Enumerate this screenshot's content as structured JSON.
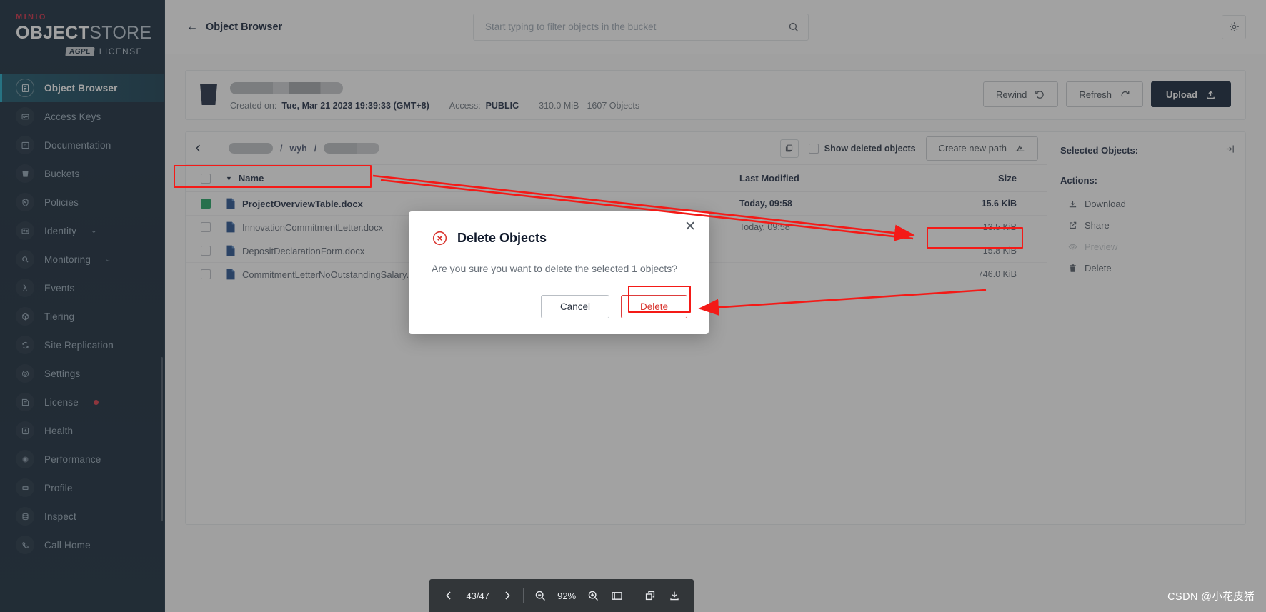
{
  "brand": {
    "minio": "MINIO",
    "object": "OBJECT",
    "store": "STORE",
    "badge": "AGPL",
    "license": "LICENSE"
  },
  "sidebar": {
    "items": [
      {
        "label": "Object Browser",
        "icon": "object-browser-icon",
        "active": true
      },
      {
        "label": "Access Keys",
        "icon": "key-icon"
      },
      {
        "label": "Documentation",
        "icon": "book-icon"
      },
      {
        "label": "Buckets",
        "icon": "bucket-icon"
      },
      {
        "label": "Policies",
        "icon": "shield-icon"
      },
      {
        "label": "Identity",
        "icon": "identity-icon",
        "chevron": "⌄"
      },
      {
        "label": "Monitoring",
        "icon": "magnifier-icon",
        "chevron": "⌄"
      },
      {
        "label": "Events",
        "icon": "lambda-icon"
      },
      {
        "label": "Tiering",
        "icon": "cube-icon"
      },
      {
        "label": "Site Replication",
        "icon": "replication-icon"
      },
      {
        "label": "Settings",
        "icon": "gear-icon"
      },
      {
        "label": "License",
        "icon": "license-icon",
        "dot": true
      },
      {
        "label": "Health",
        "icon": "health-icon"
      },
      {
        "label": "Performance",
        "icon": "speed-icon"
      },
      {
        "label": "Profile",
        "icon": "profile-icon"
      },
      {
        "label": "Inspect",
        "icon": "inspect-icon"
      },
      {
        "label": "Call Home",
        "icon": "phone-icon"
      }
    ]
  },
  "topbar": {
    "back_arrow": "←",
    "title": "Object Browser",
    "search_placeholder": "Start typing to filter objects in the bucket",
    "search_value": "",
    "search_icon": "search-icon",
    "settings_icon": "gear-icon"
  },
  "bucket": {
    "created_label": "Created on:",
    "created_value": "Tue, Mar 21 2023 19:39:33 (GMT+8)",
    "access_label": "Access:",
    "access_value": "PUBLIC",
    "stats": "310.0 MiB - 1607 Objects",
    "buttons": {
      "rewind": "Rewind",
      "refresh": "Refresh",
      "upload": "Upload"
    }
  },
  "pathbar": {
    "back_icon": "chevron-left-icon",
    "separator_1": "/",
    "crumb_middle": "wyh",
    "separator_2": "/",
    "copy_icon": "copy-icon",
    "show_deleted_label": "Show deleted objects",
    "show_deleted_checked": false,
    "create_path_label": "Create new path"
  },
  "table": {
    "columns": {
      "name": "Name",
      "last_modified": "Last Modified",
      "size": "Size"
    },
    "sort_caret": "▼",
    "rows": [
      {
        "name": "ProjectOverviewTable.docx",
        "modified": "Today, 09:58",
        "size": "15.6 KiB",
        "selected": true
      },
      {
        "name": "InnovationCommitmentLetter.docx",
        "modified": "Today, 09:58",
        "size": "13.5 KiB",
        "selected": false
      },
      {
        "name": "DepositDeclarationForm.docx",
        "modified": "",
        "size": "15.8 KiB",
        "selected": false
      },
      {
        "name": "CommitmentLetterNoOutstandingSalary.docx",
        "modified": "",
        "size": "746.0 KiB",
        "selected": false
      }
    ]
  },
  "selected_panel": {
    "title": "Selected Objects:",
    "collapse_icon": "collapse-right-icon",
    "actions_title": "Actions:",
    "actions": [
      {
        "label": "Download",
        "icon": "download-icon",
        "disabled": false
      },
      {
        "label": "Share",
        "icon": "share-icon",
        "disabled": false
      },
      {
        "label": "Preview",
        "icon": "eye-icon",
        "disabled": true
      },
      {
        "label": "Delete",
        "icon": "trash-icon",
        "disabled": false
      }
    ]
  },
  "dialog": {
    "title": "Delete Objects",
    "icon": "error-circle-icon",
    "message": "Are you sure you want to delete the selected 1 objects?",
    "cancel_label": "Cancel",
    "delete_label": "Delete",
    "close_icon": "close-icon"
  },
  "pdf_toolbar": {
    "prev_icon": "chevron-left-icon",
    "page": "43/47",
    "next_icon": "chevron-right-icon",
    "zoom_out_icon": "zoom-out-icon",
    "zoom_level": "92%",
    "zoom_in_icon": "zoom-in-icon",
    "fit_icon": "fit-page-icon",
    "rotate_icon": "rotate-icon",
    "download_icon": "download-icon"
  },
  "watermark": "CSDN @小花皮猪",
  "colors": {
    "accent_red": "#f41a17",
    "sidebar_bg": "#0b2033",
    "primary_dark": "#07182e",
    "selected_green": "#14a05a",
    "license_dot": "#d8313f"
  }
}
